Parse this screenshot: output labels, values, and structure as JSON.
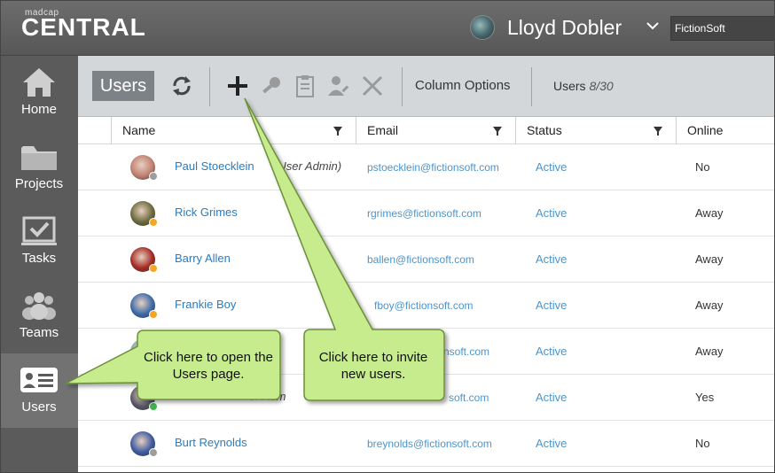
{
  "header": {
    "brand_small": "madcap",
    "brand_big": "CENTRAL",
    "user_name": "Lloyd Dobler",
    "company": "FictionSoft"
  },
  "sidebar": {
    "items": [
      {
        "label": "Home",
        "icon": "home-icon"
      },
      {
        "label": "Projects",
        "icon": "folder-icon"
      },
      {
        "label": "Tasks",
        "icon": "tasks-icon"
      },
      {
        "label": "Teams",
        "icon": "teams-icon"
      },
      {
        "label": "Users",
        "icon": "users-card-icon",
        "active": true
      }
    ]
  },
  "toolbar": {
    "users_label": "Users",
    "icons": [
      "refresh-icon",
      "add-icon",
      "key-icon",
      "clipboard-icon",
      "user-edit-icon",
      "delete-icon"
    ],
    "column_options": "Column Options",
    "users_count_label": "Users",
    "users_count": "8/30"
  },
  "table": {
    "headers": [
      "Name",
      "Email",
      "Status",
      "Online"
    ],
    "rows": [
      {
        "name": "Paul Stoecklein",
        "role": "(User Admin)",
        "email": "pstoecklein@fictionsoft.com",
        "status": "Active",
        "online": "No",
        "dot": "#9e9e9e",
        "avatar": "#c08070"
      },
      {
        "name": "Rick Grimes",
        "role": "",
        "email": "rgrimes@fictionsoft.com",
        "status": "Active",
        "online": "Away",
        "dot": "#f5a623",
        "avatar": "#6b6a3c"
      },
      {
        "name": "Barry Allen",
        "role": "",
        "email": "ballen@fictionsoft.com",
        "status": "Active",
        "online": "Away",
        "dot": "#f5a623",
        "avatar": "#a32a22"
      },
      {
        "name": "Frankie Boy",
        "role": "",
        "email": "fboy@fictionsoft.com",
        "status": "Active",
        "online": "Away",
        "dot": "#f5a623",
        "avatar": "#3c6aa8"
      },
      {
        "name": "",
        "role": "",
        "email": "nsoft.com",
        "status": "Active",
        "online": "Away",
        "dot": "#f5a623",
        "avatar": "#8aa"
      },
      {
        "name": "",
        "role": "er Adm",
        "email": "soft.com",
        "status": "Active",
        "online": "Yes",
        "dot": "#3cb44b",
        "avatar": "#556"
      },
      {
        "name": "Burt Reynolds",
        "role": "",
        "email": "breynolds@fictionsoft.com",
        "status": "Active",
        "online": "No",
        "dot": "#9e9e9e",
        "avatar": "#3d5aa0"
      }
    ]
  },
  "callouts": {
    "users_page": "Click here to open the Users page.",
    "invite": "Click here to invite new users."
  },
  "colors": {
    "callout_fill": "#c6ec8e",
    "callout_stroke": "#6c8f3a",
    "link": "#2a7bbf"
  }
}
